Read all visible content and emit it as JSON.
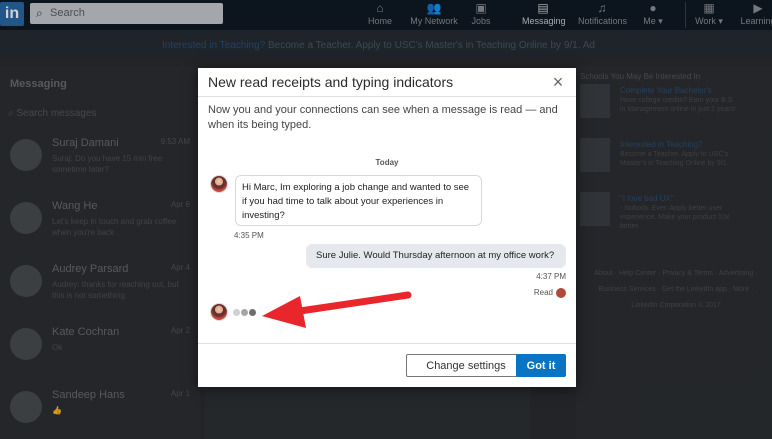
{
  "nav": {
    "logo": "in",
    "search_placeholder": "Search",
    "items": [
      {
        "label": "Home",
        "icon": "home-icon",
        "glyph": "⌂"
      },
      {
        "label": "My Network",
        "icon": "people-icon",
        "glyph": "👥"
      },
      {
        "label": "Jobs",
        "icon": "briefcase-icon",
        "glyph": "▣"
      },
      {
        "label": "Messaging",
        "icon": "chat-icon",
        "glyph": "▤"
      },
      {
        "label": "Notifications",
        "icon": "bell-icon",
        "glyph": "♫"
      },
      {
        "label": "Me ▾",
        "icon": "avatar-icon",
        "glyph": "●"
      },
      {
        "label": "Work ▾",
        "icon": "grid-icon",
        "glyph": "▦"
      },
      {
        "label": "Learning",
        "icon": "play-icon",
        "glyph": "▶"
      }
    ]
  },
  "promo": {
    "link": "Interested in Teaching?",
    "text": " Become a Teacher. Apply to USC's Master's in Teaching Online by 9/1.",
    "ad": "Ad"
  },
  "messaging": {
    "title": "Messaging",
    "search_placeholder": "Search messages",
    "conversations": [
      {
        "name": "Suraj Damani",
        "date": "9:53 AM",
        "preview": "Suraj: Do you have 15 min free sometime later?"
      },
      {
        "name": "Wang He",
        "date": "Apr 6",
        "preview": "Let's keep in touch and grab coffee when you're back"
      },
      {
        "name": "Audrey Parsard",
        "date": "Apr 4",
        "preview": "Audrey: thanks for reaching out, but this is not something"
      },
      {
        "name": "Kate Cochran",
        "date": "Apr 2",
        "preview": "Ok"
      },
      {
        "name": "Sandeep Hans",
        "date": "Apr 1",
        "preview": "👍"
      }
    ]
  },
  "sidebar": {
    "title": "Schools You May Be Interested In",
    "items": [
      {
        "title": "Complete Your Bachelor's",
        "desc": "Have college credits? Earn your B.S. in Management online in just 2 years!"
      },
      {
        "title": "Interested in Teaching?",
        "desc": "Become a Teacher. Apply to USC's Master's in Teaching Online by 9/1."
      },
      {
        "title": "\"I love bad UX\"",
        "desc": "- Nobody. Ever. Apply better user experience. Make your product 10x better."
      }
    ],
    "footer": "About · Help Center · Privacy & Terms · Advertising · Business Services · Get the LinkedIn app · More · LinkedIn Corporation © 2017"
  },
  "modal": {
    "title": "New read receipts and typing indicators",
    "description": "Now you and your connections can see when a message is read — and when its being typed.",
    "day_label": "Today",
    "incoming_message": "Hi Marc, Im exploring a job change and wanted to see if you had time to talk about your experiences in investing?",
    "incoming_time": "4:35 PM",
    "outgoing_message": "Sure Julie. Would Thursday afternoon at my office work?",
    "outgoing_time": "4:37 PM",
    "read_label": "Read",
    "change_settings_label": "Change settings",
    "got_it_label": "Got it"
  },
  "colors": {
    "accent": "#0a74c4",
    "arrow": "#e8262b",
    "bubble_out": "#e5e9ee"
  }
}
